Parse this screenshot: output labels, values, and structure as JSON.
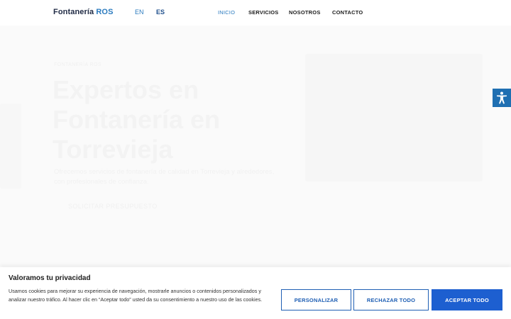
{
  "header": {
    "logo_text": "Fontanería",
    "logo_accent": "ROS",
    "languages": [
      {
        "label": "EN",
        "active": false
      },
      {
        "label": "ES",
        "active": true
      }
    ],
    "nav": [
      {
        "label": "INICIO",
        "active": true
      },
      {
        "label": "SERVICIOS",
        "active": false
      },
      {
        "label": "NOSOTROS",
        "active": false
      },
      {
        "label": "CONTACTO",
        "active": false
      }
    ]
  },
  "hero": {
    "eyebrow": "FONTANERÍA ROS",
    "title": "Expertos en Fontanería en Torrevieja",
    "description": "Ofrecemos servicios de fontanería de calidad en Torrevieja y alrededores, con profesionales de confianza.",
    "cta": "SOLICITAR PRESUPUESTO"
  },
  "accessibility": {
    "icon": "accessibility-icon"
  },
  "cookie_banner": {
    "title": "Valoramos tu privacidad",
    "text": "Usamos cookies para mejorar su experiencia de navegación, mostrarle anuncios o contenidos personalizados y analizar nuestro tráfico. Al hacer clic en “Aceptar todo” usted da su consentimiento a nuestro uso de las cookies.",
    "buttons": {
      "customize": "PERSONALIZAR",
      "reject": "RECHAZAR TODO",
      "accept": "ACEPTAR TODO"
    }
  },
  "colors": {
    "accent": "#2b7bbf",
    "primary_button": "#1d5fd0",
    "accessibility_button": "#1f6fb2"
  }
}
